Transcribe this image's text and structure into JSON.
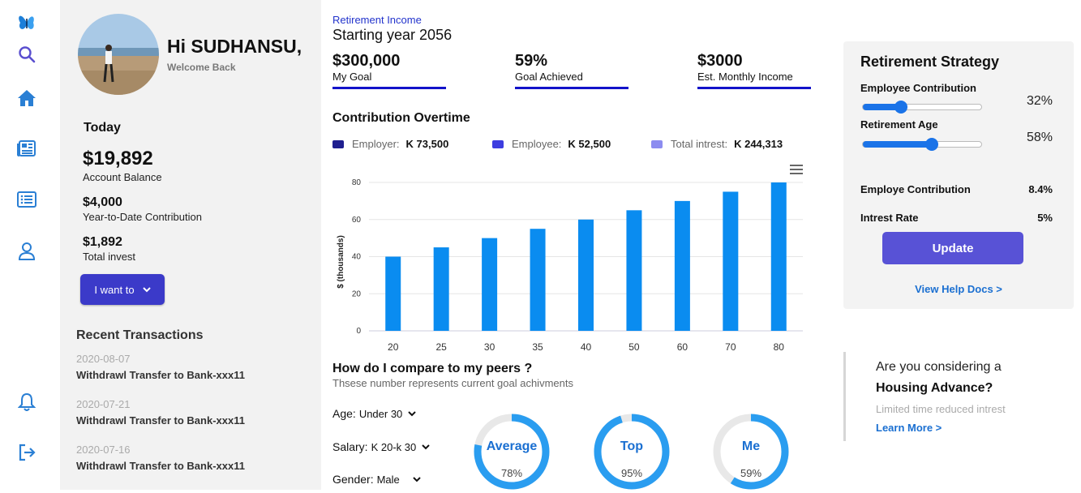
{
  "profile": {
    "greeting": "Hi SUDHANSU,",
    "welcome": "Welcome Back",
    "today": "Today",
    "balance": "$19,892",
    "balance_label": "Account Balance",
    "ytd": "$4,000",
    "ytd_label": "Year-to-Date Contribution",
    "total": "$1,892",
    "total_label": "Total invest",
    "i_want_to": "I want to",
    "recent_title": "Recent Transactions",
    "transactions": [
      {
        "date": "2020-08-07",
        "desc": "Withdrawl Transfer to Bank-xxx11"
      },
      {
        "date": "2020-07-21",
        "desc": "Withdrawl Transfer to Bank-xxx11"
      },
      {
        "date": "2020-07-16",
        "desc": "Withdrawl Transfer to Bank-xxx11"
      }
    ]
  },
  "main": {
    "label": "Retirement Income",
    "start": "Starting year 2056",
    "stats": [
      {
        "value": "$300,000",
        "label": "My Goal"
      },
      {
        "value": "59%",
        "label": "Goal Achieved"
      },
      {
        "value": "$3000",
        "label": "Est. Monthly Income"
      }
    ],
    "contrib_title": "Contribution Overtime",
    "legend": [
      {
        "label": "Employer:",
        "value": "K 73,500",
        "color": "#1f1f8f"
      },
      {
        "label": "Employee:",
        "value": "K 52,500",
        "color": "#3d3de0"
      },
      {
        "label": "Total intrest:",
        "value": "K 244,313",
        "color": "#8c8cf0"
      }
    ],
    "peers_title": "How do I compare to my peers ?",
    "peers_sub": "Thsese number represents current goal achivments",
    "filters": {
      "age_label": "Age:",
      "age_value": "Under 30",
      "salary_label": "Salary:",
      "salary_value": "K 20-k 30",
      "gender_label": "Gender:",
      "gender_value": "Male"
    },
    "rings": [
      {
        "label": "Average",
        "pct_text": "78%",
        "pct": 0.78
      },
      {
        "label": "Top",
        "pct_text": "95%",
        "pct": 0.95
      },
      {
        "label": "Me",
        "pct_text": "59%",
        "pct": 0.59
      }
    ]
  },
  "chart_data": {
    "type": "bar",
    "categories": [
      "20",
      "25",
      "30",
      "35",
      "40",
      "50",
      "60",
      "70",
      "80"
    ],
    "values": [
      40,
      45,
      50,
      55,
      60,
      65,
      70,
      75,
      80
    ],
    "ylabel": "$ (thousands)",
    "ylim": [
      0,
      80
    ],
    "yticks": [
      0,
      20,
      40,
      60,
      80
    ],
    "grid": true,
    "color": "#0a8cf0"
  },
  "strategy": {
    "title": "Retirement Strategy",
    "emp_contrib_label": "Employee Contribution",
    "emp_contrib_pct": "32%",
    "emp_contrib_level": 0.32,
    "ret_age_label": "Retirement Age",
    "ret_age_pct": "58%",
    "ret_age_level": 0.58,
    "employe_contrib_label": "Employe Contribution",
    "employe_contrib_value": "8.4%",
    "interest_label": "Intrest Rate",
    "interest_value": "5%",
    "update": "Update",
    "help": "View Help Docs >"
  },
  "housing": {
    "question": "Are you considering a",
    "title": "Housing Advance?",
    "sub": "Limited time reduced intrest",
    "link": "Learn More >"
  },
  "colors": {
    "accent": "#1a73e8",
    "brand_button": "#3b3ac9",
    "update_button": "#5852d6",
    "stat_underline": "#1212c9"
  }
}
